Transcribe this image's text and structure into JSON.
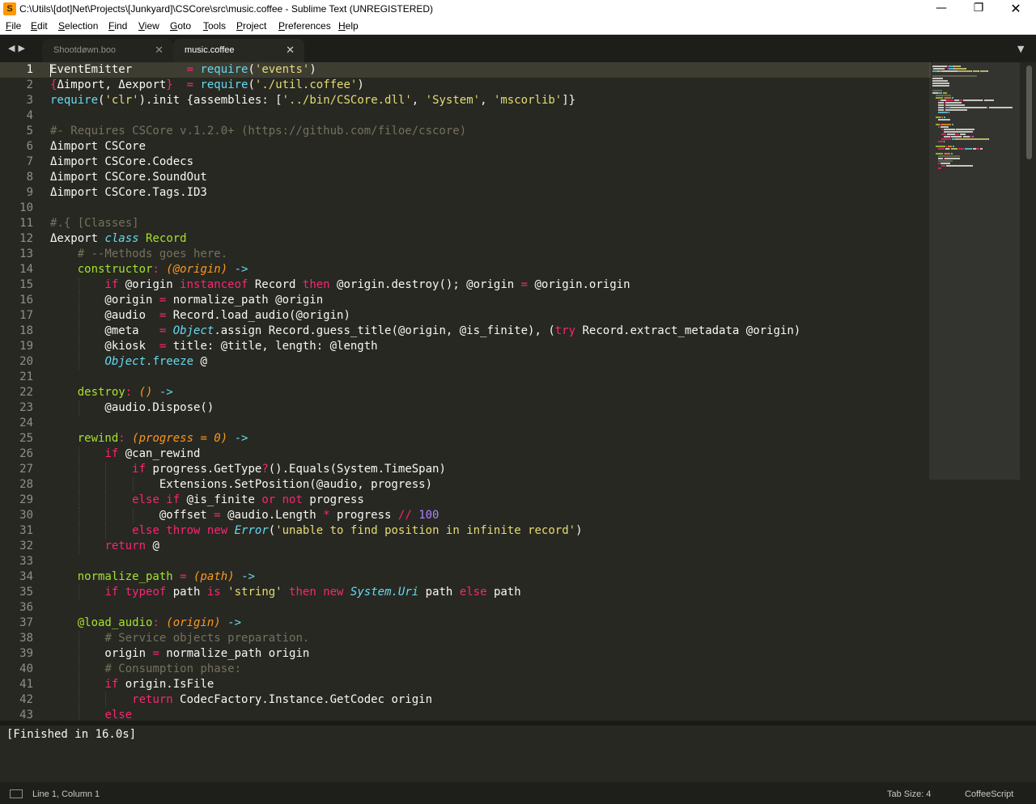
{
  "window": {
    "title": "C:\\Utils\\[dot]Net\\Projects\\[Junkyard]\\CSCore\\src\\music.coffee - Sublime Text (UNREGISTERED)",
    "app_icon": "S",
    "minimize_glyph": "—",
    "maximize_glyph": "❐",
    "close_glyph": "✕"
  },
  "menu": [
    "File",
    "Edit",
    "Selection",
    "Find",
    "View",
    "Goto",
    "Tools",
    "Project",
    "Preferences",
    "Help"
  ],
  "tabs": {
    "nav_arrows": "◀▶",
    "items": [
      {
        "label": "Shootdøwn.boo",
        "close": "✕",
        "active": false
      },
      {
        "label": "music.coffee",
        "close": "✕",
        "active": true
      }
    ],
    "dropdown_glyph": "▼"
  },
  "editor": {
    "current_line": 1,
    "lines": [
      {
        "n": "1",
        "t": [
          [
            "EventEmitter        ",
            ""
          ],
          [
            "= ",
            "k"
          ],
          [
            "require",
            "b"
          ],
          [
            "(",
            ""
          ],
          [
            "'events'",
            "s"
          ],
          [
            ")",
            ""
          ]
        ]
      },
      {
        "n": "2",
        "t": [
          [
            "{",
            "k"
          ],
          [
            "Δimport, Δexport",
            ""
          ],
          [
            "}",
            "k"
          ],
          [
            "  ",
            ""
          ],
          [
            "= ",
            "k"
          ],
          [
            "require",
            "b"
          ],
          [
            "(",
            ""
          ],
          [
            "'./util.coffee'",
            "s"
          ],
          [
            ")",
            ""
          ]
        ]
      },
      {
        "n": "3",
        "t": [
          [
            "require",
            "b"
          ],
          [
            "(",
            ""
          ],
          [
            "'clr'",
            "s"
          ],
          [
            ").init {assemblies: [",
            ""
          ],
          [
            "'../bin/CSCore.dll'",
            "s"
          ],
          [
            ", ",
            ""
          ],
          [
            "'System'",
            "s"
          ],
          [
            ", ",
            ""
          ],
          [
            "'mscorlib'",
            "s"
          ],
          [
            "]}",
            ""
          ]
        ]
      },
      {
        "n": "4",
        "t": []
      },
      {
        "n": "5",
        "t": [
          [
            "#- Requires CSCore v.1.2.0+ (https://github.com/filoe/cscore)",
            "c"
          ]
        ]
      },
      {
        "n": "6",
        "t": [
          [
            "Δimport CSCore",
            ""
          ]
        ]
      },
      {
        "n": "7",
        "t": [
          [
            "Δimport CSCore.Codecs",
            ""
          ]
        ]
      },
      {
        "n": "8",
        "t": [
          [
            "Δimport CSCore.SoundOut",
            ""
          ]
        ]
      },
      {
        "n": "9",
        "t": [
          [
            "Δimport CSCore.Tags.ID3",
            ""
          ]
        ]
      },
      {
        "n": "10",
        "t": []
      },
      {
        "n": "11",
        "t": [
          [
            "#.{ [Classes]",
            "c"
          ]
        ]
      },
      {
        "n": "12",
        "t": [
          [
            "Δexport ",
            ""
          ],
          [
            "class",
            "bi"
          ],
          [
            " ",
            ""
          ],
          [
            "Record",
            "f"
          ]
        ]
      },
      {
        "n": "13",
        "t": [
          [
            "    ",
            ""
          ],
          [
            "# --Methods goes here.",
            "c"
          ]
        ]
      },
      {
        "n": "14",
        "t": [
          [
            "    ",
            ""
          ],
          [
            "constructor",
            "f"
          ],
          [
            ": ",
            "k"
          ],
          [
            "(@origin)",
            "p"
          ],
          [
            " ",
            ""
          ],
          [
            "->",
            "b"
          ]
        ]
      },
      {
        "n": "15",
        "t": [
          [
            "        ",
            ""
          ],
          [
            "if",
            "k"
          ],
          [
            " @origin ",
            ""
          ],
          [
            "instanceof",
            "k"
          ],
          [
            " Record ",
            ""
          ],
          [
            "then",
            "k"
          ],
          [
            " @origin.destroy(); @origin ",
            ""
          ],
          [
            "=",
            "k"
          ],
          [
            " @origin.origin",
            ""
          ]
        ]
      },
      {
        "n": "16",
        "t": [
          [
            "        @origin ",
            ""
          ],
          [
            "=",
            "k"
          ],
          [
            " normalize_path @origin",
            ""
          ]
        ]
      },
      {
        "n": "17",
        "t": [
          [
            "        @audio  ",
            ""
          ],
          [
            "=",
            "k"
          ],
          [
            " Record.load_audio(@origin)",
            ""
          ]
        ]
      },
      {
        "n": "18",
        "t": [
          [
            "        @meta   ",
            ""
          ],
          [
            "=",
            "k"
          ],
          [
            " ",
            ""
          ],
          [
            "Object",
            "bi"
          ],
          [
            ".assign Record.guess_title(@origin, @is_finite), (",
            ""
          ],
          [
            "try",
            "k"
          ],
          [
            " Record.extract_metadata @origin)",
            ""
          ]
        ]
      },
      {
        "n": "19",
        "t": [
          [
            "        @kiosk  ",
            ""
          ],
          [
            "=",
            "k"
          ],
          [
            " title: @title, length: @length",
            ""
          ]
        ]
      },
      {
        "n": "20",
        "t": [
          [
            "        ",
            ""
          ],
          [
            "Object",
            "bi"
          ],
          [
            ".freeze",
            "b"
          ],
          [
            " @",
            ""
          ]
        ]
      },
      {
        "n": "21",
        "t": []
      },
      {
        "n": "22",
        "t": [
          [
            "    ",
            ""
          ],
          [
            "destroy",
            "f"
          ],
          [
            ": ",
            "k"
          ],
          [
            "()",
            "p"
          ],
          [
            " ",
            ""
          ],
          [
            "->",
            "b"
          ]
        ]
      },
      {
        "n": "23",
        "t": [
          [
            "        @audio.Dispose()",
            ""
          ]
        ]
      },
      {
        "n": "24",
        "t": []
      },
      {
        "n": "25",
        "t": [
          [
            "    ",
            ""
          ],
          [
            "rewind",
            "f"
          ],
          [
            ": ",
            "k"
          ],
          [
            "(progress = 0)",
            "p"
          ],
          [
            " ",
            ""
          ],
          [
            "->",
            "b"
          ]
        ]
      },
      {
        "n": "26",
        "t": [
          [
            "        ",
            ""
          ],
          [
            "if",
            "k"
          ],
          [
            " @can_rewind",
            ""
          ]
        ]
      },
      {
        "n": "27",
        "t": [
          [
            "            ",
            ""
          ],
          [
            "if",
            "k"
          ],
          [
            " progress.GetType",
            ""
          ],
          [
            "?",
            "k"
          ],
          [
            "().Equals(System.TimeSpan)",
            ""
          ]
        ]
      },
      {
        "n": "28",
        "t": [
          [
            "                Extensions.SetPosition(@audio, progress)",
            ""
          ]
        ]
      },
      {
        "n": "29",
        "t": [
          [
            "            ",
            ""
          ],
          [
            "else if",
            "k"
          ],
          [
            " @is_finite ",
            ""
          ],
          [
            "or not",
            "k"
          ],
          [
            " progress",
            ""
          ]
        ]
      },
      {
        "n": "30",
        "t": [
          [
            "                @offset ",
            ""
          ],
          [
            "=",
            "k"
          ],
          [
            " @audio.Length ",
            ""
          ],
          [
            "*",
            "k"
          ],
          [
            " progress ",
            ""
          ],
          [
            "//",
            "k"
          ],
          [
            " ",
            ""
          ],
          [
            "100",
            "n"
          ]
        ]
      },
      {
        "n": "31",
        "t": [
          [
            "            ",
            ""
          ],
          [
            "else throw new",
            "k"
          ],
          [
            " ",
            ""
          ],
          [
            "Error",
            "bi"
          ],
          [
            "(",
            ""
          ],
          [
            "'unable to find position in infinite record'",
            "s"
          ],
          [
            ")",
            ""
          ]
        ]
      },
      {
        "n": "32",
        "t": [
          [
            "        ",
            ""
          ],
          [
            "return",
            "k"
          ],
          [
            " @",
            ""
          ]
        ]
      },
      {
        "n": "33",
        "t": []
      },
      {
        "n": "34",
        "t": [
          [
            "    ",
            ""
          ],
          [
            "normalize_path",
            "f"
          ],
          [
            " ",
            ""
          ],
          [
            "=",
            "k"
          ],
          [
            " ",
            ""
          ],
          [
            "(path)",
            "p"
          ],
          [
            " ",
            ""
          ],
          [
            "->",
            "b"
          ]
        ]
      },
      {
        "n": "35",
        "t": [
          [
            "        ",
            ""
          ],
          [
            "if typeof",
            "k"
          ],
          [
            " path ",
            ""
          ],
          [
            "is",
            "k"
          ],
          [
            " ",
            ""
          ],
          [
            "'string'",
            "s"
          ],
          [
            " ",
            ""
          ],
          [
            "then new",
            "k"
          ],
          [
            " ",
            ""
          ],
          [
            "System.Uri",
            "bi"
          ],
          [
            " path ",
            ""
          ],
          [
            "else",
            "k"
          ],
          [
            " path",
            ""
          ]
        ]
      },
      {
        "n": "36",
        "t": []
      },
      {
        "n": "37",
        "t": [
          [
            "    ",
            ""
          ],
          [
            "@load_audio",
            "f"
          ],
          [
            ": ",
            "k"
          ],
          [
            "(origin)",
            "p"
          ],
          [
            " ",
            ""
          ],
          [
            "->",
            "b"
          ]
        ]
      },
      {
        "n": "38",
        "t": [
          [
            "        ",
            ""
          ],
          [
            "# Service objects preparation.",
            "c"
          ]
        ]
      },
      {
        "n": "39",
        "t": [
          [
            "        origin ",
            ""
          ],
          [
            "=",
            "k"
          ],
          [
            " normalize_path origin",
            ""
          ]
        ]
      },
      {
        "n": "40",
        "t": [
          [
            "        ",
            ""
          ],
          [
            "# Consumption phase:",
            "c"
          ]
        ]
      },
      {
        "n": "41",
        "t": [
          [
            "        ",
            ""
          ],
          [
            "if",
            "k"
          ],
          [
            " origin.IsFile",
            ""
          ]
        ]
      },
      {
        "n": "42",
        "t": [
          [
            "            ",
            ""
          ],
          [
            "return",
            "k"
          ],
          [
            " CodecFactory.Instance.GetCodec origin",
            ""
          ]
        ]
      },
      {
        "n": "43",
        "t": [
          [
            "        ",
            ""
          ],
          [
            "else",
            "k"
          ]
        ]
      }
    ]
  },
  "output": {
    "text": "[Finished in 16.0s]"
  },
  "statusbar": {
    "position": "Line 1, Column 1",
    "tab_size": "Tab Size: 4",
    "syntax": "CoffeeScript"
  },
  "colors": {
    "background": "#272822",
    "foreground": "#f8f8f2",
    "keyword": "#f92672",
    "string": "#e6db74",
    "comment": "#75715e",
    "function": "#a6e22e",
    "builtin": "#66d9ef",
    "parameter": "#fd971f",
    "number": "#ae81ff"
  }
}
